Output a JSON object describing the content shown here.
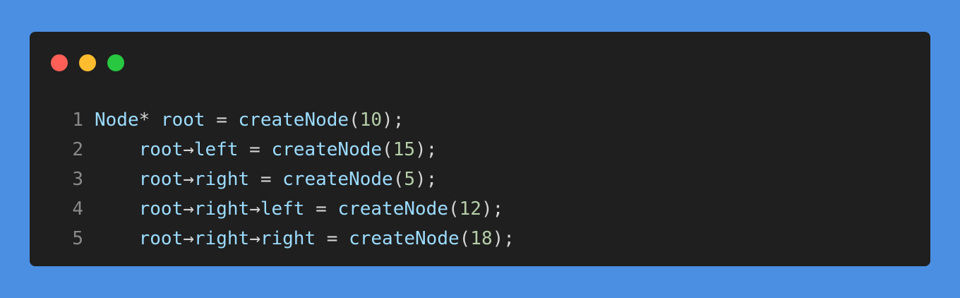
{
  "window": {
    "background": "#1f1f1f",
    "page_background": "#4a8fe2",
    "controls": [
      {
        "name": "close",
        "color": "#ff5f57"
      },
      {
        "name": "minimize",
        "color": "#febc2e"
      },
      {
        "name": "maximize",
        "color": "#28c840"
      }
    ]
  },
  "code": {
    "lines": [
      {
        "number": "1",
        "tokens": [
          {
            "t": "Node",
            "k": "id"
          },
          {
            "t": "*",
            "k": "op"
          },
          {
            "t": " ",
            "k": "op"
          },
          {
            "t": "root",
            "k": "id"
          },
          {
            "t": " = ",
            "k": "op"
          },
          {
            "t": "createNode",
            "k": "fn"
          },
          {
            "t": "(",
            "k": "punc"
          },
          {
            "t": "10",
            "k": "num"
          },
          {
            "t": ");",
            "k": "punc"
          }
        ]
      },
      {
        "number": "2",
        "tokens": [
          {
            "t": "    ",
            "k": "op"
          },
          {
            "t": "root",
            "k": "id"
          },
          {
            "t": "→",
            "k": "op"
          },
          {
            "t": "left",
            "k": "id"
          },
          {
            "t": " = ",
            "k": "op"
          },
          {
            "t": "createNode",
            "k": "fn"
          },
          {
            "t": "(",
            "k": "punc"
          },
          {
            "t": "15",
            "k": "num"
          },
          {
            "t": ");",
            "k": "punc"
          }
        ]
      },
      {
        "number": "3",
        "tokens": [
          {
            "t": "    ",
            "k": "op"
          },
          {
            "t": "root",
            "k": "id"
          },
          {
            "t": "→",
            "k": "op"
          },
          {
            "t": "right",
            "k": "id"
          },
          {
            "t": " = ",
            "k": "op"
          },
          {
            "t": "createNode",
            "k": "fn"
          },
          {
            "t": "(",
            "k": "punc"
          },
          {
            "t": "5",
            "k": "num"
          },
          {
            "t": ");",
            "k": "punc"
          }
        ]
      },
      {
        "number": "4",
        "tokens": [
          {
            "t": "    ",
            "k": "op"
          },
          {
            "t": "root",
            "k": "id"
          },
          {
            "t": "→",
            "k": "op"
          },
          {
            "t": "right",
            "k": "id"
          },
          {
            "t": "→",
            "k": "op"
          },
          {
            "t": "left",
            "k": "id"
          },
          {
            "t": " = ",
            "k": "op"
          },
          {
            "t": "createNode",
            "k": "fn"
          },
          {
            "t": "(",
            "k": "punc"
          },
          {
            "t": "12",
            "k": "num"
          },
          {
            "t": ");",
            "k": "punc"
          }
        ]
      },
      {
        "number": "5",
        "tokens": [
          {
            "t": "    ",
            "k": "op"
          },
          {
            "t": "root",
            "k": "id"
          },
          {
            "t": "→",
            "k": "op"
          },
          {
            "t": "right",
            "k": "id"
          },
          {
            "t": "→",
            "k": "op"
          },
          {
            "t": "right",
            "k": "id"
          },
          {
            "t": " = ",
            "k": "op"
          },
          {
            "t": "createNode",
            "k": "fn"
          },
          {
            "t": "(",
            "k": "punc"
          },
          {
            "t": "18",
            "k": "num"
          },
          {
            "t": ");",
            "k": "punc"
          }
        ]
      }
    ]
  }
}
